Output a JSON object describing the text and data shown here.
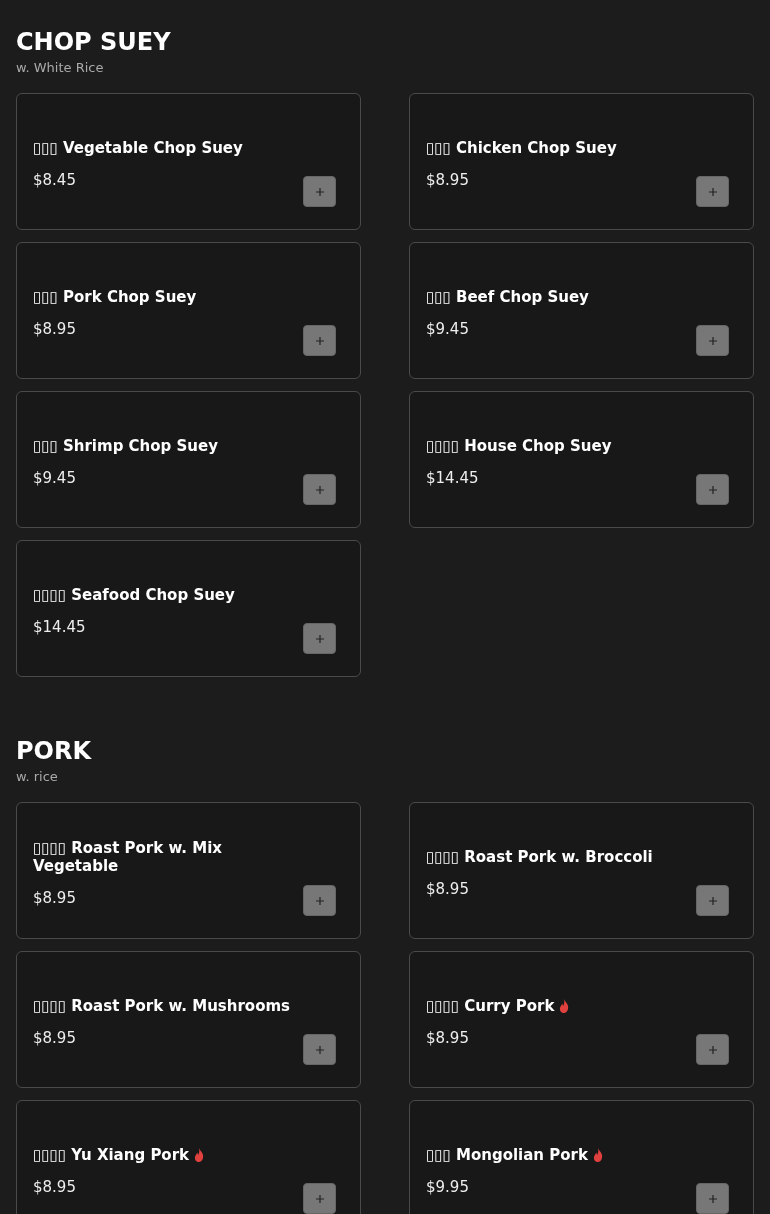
{
  "sections": [
    {
      "title": "CHOP SUEY",
      "subtitle": "w. White Rice",
      "items": [
        {
          "name": "▯▯▯ Vegetable Chop Suey",
          "price": "$8.45",
          "spicy": false
        },
        {
          "name": "▯▯▯ Chicken Chop Suey",
          "price": "$8.95",
          "spicy": false
        },
        {
          "name": "▯▯▯ Pork Chop Suey",
          "price": "$8.95",
          "spicy": false
        },
        {
          "name": "▯▯▯ Beef Chop Suey",
          "price": "$9.45",
          "spicy": false
        },
        {
          "name": "▯▯▯ Shrimp Chop Suey",
          "price": "$9.45",
          "spicy": false
        },
        {
          "name": "▯▯▯▯ House Chop Suey",
          "price": "$14.45",
          "spicy": false
        },
        {
          "name": "▯▯▯▯ Seafood Chop Suey",
          "price": "$14.45",
          "spicy": false
        }
      ]
    },
    {
      "title": "PORK",
      "subtitle": "w. rice",
      "items": [
        {
          "name": "▯▯▯▯ Roast Pork w. Mix Vegetable",
          "price": "$8.95",
          "spicy": false
        },
        {
          "name": "▯▯▯▯ Roast Pork w. Broccoli",
          "price": "$8.95",
          "spicy": false
        },
        {
          "name": "▯▯▯▯ Roast Pork w. Mushrooms",
          "price": "$8.95",
          "spicy": false
        },
        {
          "name": "▯▯▯▯ Curry Pork",
          "price": "$8.95",
          "spicy": true
        },
        {
          "name": "▯▯▯▯ Yu Xiang Pork",
          "price": "$8.95",
          "spicy": true
        },
        {
          "name": "▯▯▯ Mongolian Pork",
          "price": "$9.95",
          "spicy": true
        }
      ]
    }
  ]
}
